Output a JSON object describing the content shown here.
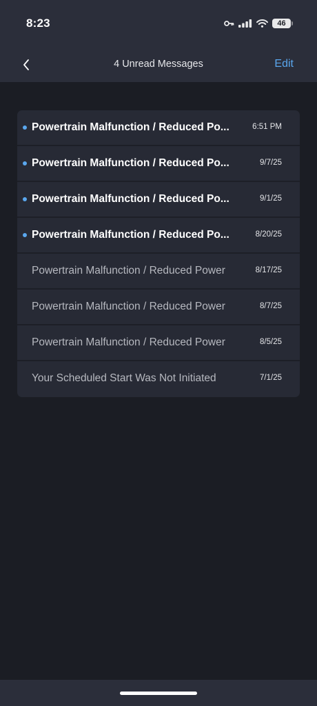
{
  "status": {
    "time": "8:23",
    "battery": "46",
    "icons": [
      "key-icon",
      "signal-icon",
      "wifi-icon",
      "battery-icon"
    ]
  },
  "nav": {
    "back_icon": "chevron-left-icon",
    "title": "4 Unread Messages",
    "edit_label": "Edit"
  },
  "colors": {
    "accent": "#5aa7ee",
    "header_bg": "#2b2e3a",
    "page_bg": "#1b1d24",
    "card_bg": "#272a35"
  },
  "messages": [
    {
      "subject": "Powertrain Malfunction / Reduced Po...",
      "date": "6:51 PM",
      "unread": true
    },
    {
      "subject": "Powertrain Malfunction / Reduced Po...",
      "date": "9/7/25",
      "unread": true
    },
    {
      "subject": "Powertrain Malfunction / Reduced Po...",
      "date": "9/1/25",
      "unread": true
    },
    {
      "subject": "Powertrain Malfunction / Reduced Po...",
      "date": "8/20/25",
      "unread": true
    },
    {
      "subject": "Powertrain Malfunction / Reduced Power",
      "date": "8/17/25",
      "unread": false
    },
    {
      "subject": "Powertrain Malfunction / Reduced Power",
      "date": "8/7/25",
      "unread": false
    },
    {
      "subject": "Powertrain Malfunction / Reduced Power",
      "date": "8/5/25",
      "unread": false
    },
    {
      "subject": "Your Scheduled Start Was Not Initiated",
      "date": "7/1/25",
      "unread": false
    }
  ]
}
